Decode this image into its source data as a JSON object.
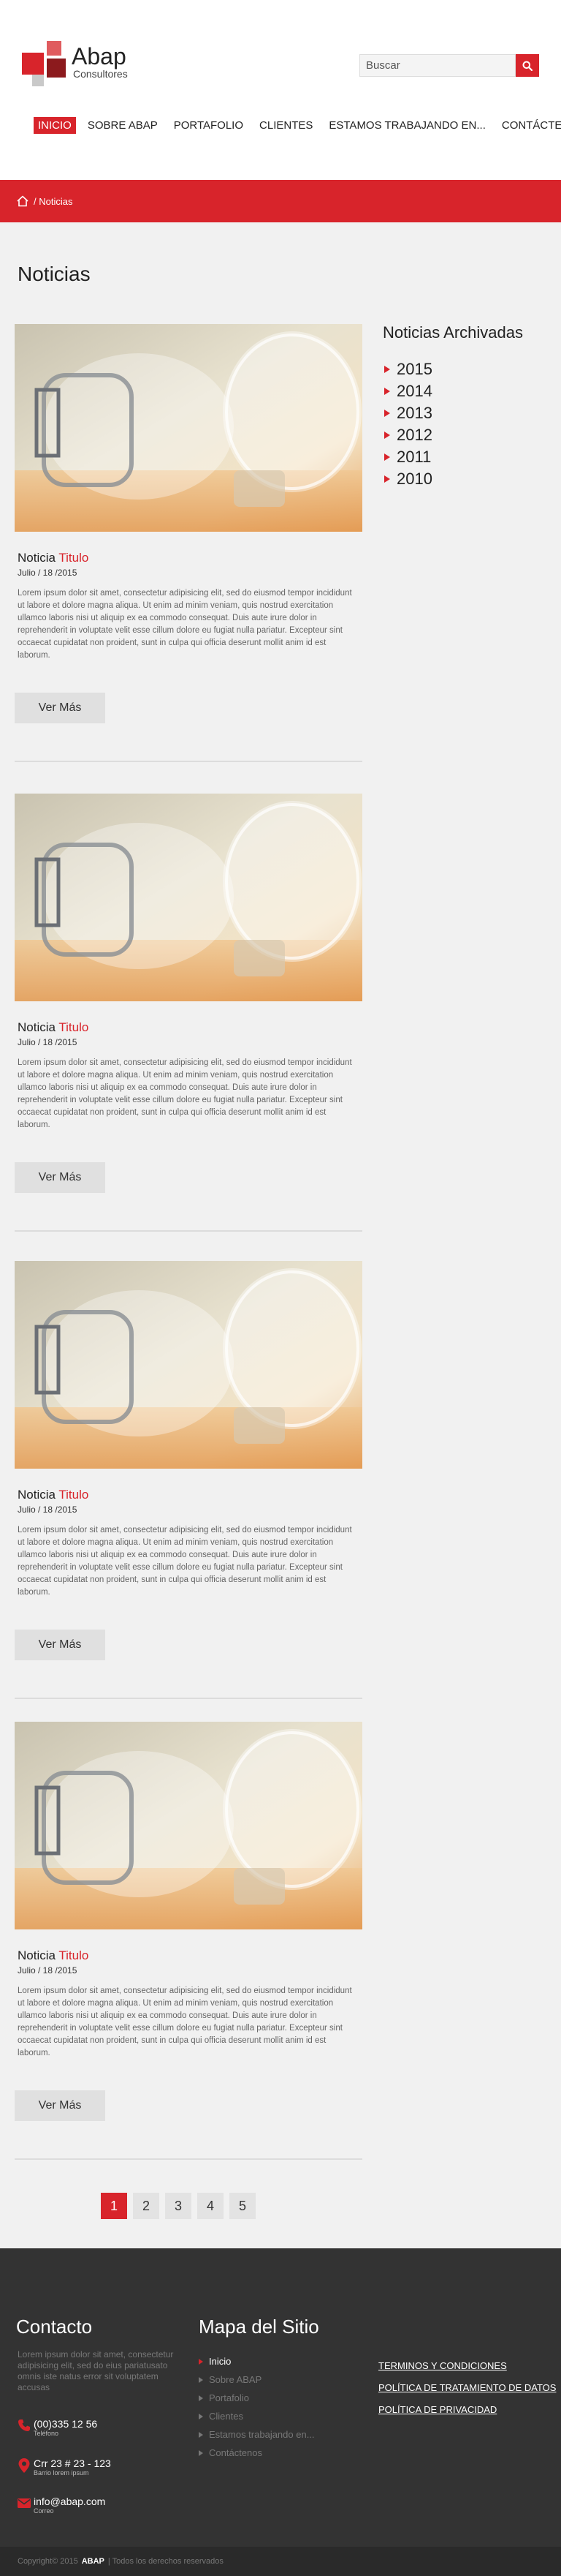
{
  "header": {
    "logo_title": "Abap",
    "logo_subtitle": "Consultores",
    "search_placeholder": "Buscar",
    "nav": [
      {
        "label": "INICIO",
        "active": true
      },
      {
        "label": "SOBRE ABAP"
      },
      {
        "label": "PORTAFOLIO"
      },
      {
        "label": "CLIENTES"
      },
      {
        "label": "ESTAMOS TRABAJANDO EN..."
      },
      {
        "label": "CONTÁCTENOS"
      }
    ]
  },
  "breadcrumb": {
    "text": "/ Noticias"
  },
  "page": {
    "title": "Noticias"
  },
  "articles": [
    {
      "title_prefix": "Noticia",
      "title_highlight": "Titulo",
      "date": "Julio / 18 /2015",
      "body": "Lorem ipsum dolor sit amet, consectetur adipisicing elit, sed do eiusmod tempor incididunt ut labore et dolore magna aliqua. Ut enim ad minim veniam, quis nostrud exercitation ullamco laboris nisi ut aliquip ex ea commodo consequat. Duis aute irure dolor in reprehenderit in voluptate velit esse cillum dolore eu fugiat nulla pariatur. Excepteur sint occaecat cupidatat non proident, sunt in culpa qui officia deserunt mollit anim id est laborum.",
      "button": "Ver Más"
    },
    {
      "title_prefix": "Noticia",
      "title_highlight": "Titulo",
      "date": "Julio / 18 /2015",
      "body": "Lorem ipsum dolor sit amet, consectetur adipisicing elit, sed do eiusmod tempor incididunt ut labore et dolore magna aliqua. Ut enim ad minim veniam, quis nostrud exercitation ullamco laboris nisi ut aliquip ex ea commodo consequat. Duis aute irure dolor in reprehenderit in voluptate velit esse cillum dolore eu fugiat nulla pariatur. Excepteur sint occaecat cupidatat non proident, sunt in culpa qui officia deserunt mollit anim id est laborum.",
      "button": "Ver Más"
    },
    {
      "title_prefix": "Noticia",
      "title_highlight": "Titulo",
      "date": "Julio / 18 /2015",
      "body": "Lorem ipsum dolor sit amet, consectetur adipisicing elit, sed do eiusmod tempor incididunt ut labore et dolore magna aliqua. Ut enim ad minim veniam, quis nostrud exercitation ullamco laboris nisi ut aliquip ex ea commodo consequat. Duis aute irure dolor in reprehenderit in voluptate velit esse cillum dolore eu fugiat nulla pariatur. Excepteur sint occaecat cupidatat non proident, sunt in culpa qui officia deserunt mollit anim id est laborum.",
      "button": "Ver Más"
    },
    {
      "title_prefix": "Noticia",
      "title_highlight": "Titulo",
      "date": "Julio / 18 /2015",
      "body": "Lorem ipsum dolor sit amet, consectetur adipisicing elit, sed do eiusmod tempor incididunt ut labore et dolore magna aliqua. Ut enim ad minim veniam, quis nostrud exercitation ullamco laboris nisi ut aliquip ex ea commodo consequat. Duis aute irure dolor in reprehenderit in voluptate velit esse cillum dolore eu fugiat nulla pariatur. Excepteur sint occaecat cupidatat non proident, sunt in culpa qui officia deserunt mollit anim id est laborum.",
      "button": "Ver Más"
    }
  ],
  "archive": {
    "title": "Noticias Archivadas",
    "years": [
      "2015",
      "2014",
      "2013",
      "2012",
      "2011",
      "2010"
    ]
  },
  "pagination": {
    "pages": [
      "1",
      "2",
      "3",
      "4",
      "5"
    ],
    "current": "1"
  },
  "footer": {
    "contact_title": "Contacto",
    "contact_intro": "Lorem ipsum dolor sit amet, consectetur adipisicing elit, sed do eius pariatusato omnis iste natus error sit voluptatem accusas",
    "phone": {
      "value": "(00)335 12 56",
      "label": "Teléfono"
    },
    "address": {
      "value": "Crr 23 # 23 - 123",
      "label": "Barrio lorem ipsum"
    },
    "email": {
      "value": "info@abap.com",
      "label": "Correo"
    },
    "sitemap_title": "Mapa del Sitio",
    "sitemap": [
      {
        "label": "Inicio",
        "current": true
      },
      {
        "label": "Sobre ABAP"
      },
      {
        "label": "Portafolio"
      },
      {
        "label": "Clientes"
      },
      {
        "label": "Estamos trabajando en..."
      },
      {
        "label": "Contáctenos"
      }
    ],
    "legal": [
      "TERMINOS Y CONDICIONES",
      "POLÍTICA DE TRATAMIENTO DE DATOS",
      "POLÍTICA DE PRIVACIDAD"
    ],
    "copyright_prefix": "Copyright© 2015",
    "copyright_brand": "ABAP",
    "copyright_suffix": "| Todos los derechos reservados"
  },
  "colors": {
    "accent": "#d8242b",
    "footer_bg": "#333333",
    "page_bg": "#f1f1f1"
  },
  "icons": {
    "search": "search-icon",
    "home": "home-icon",
    "phone": "phone-icon",
    "location": "location-pin-icon",
    "email": "envelope-icon",
    "bullet": "triangle-bullet-icon"
  }
}
